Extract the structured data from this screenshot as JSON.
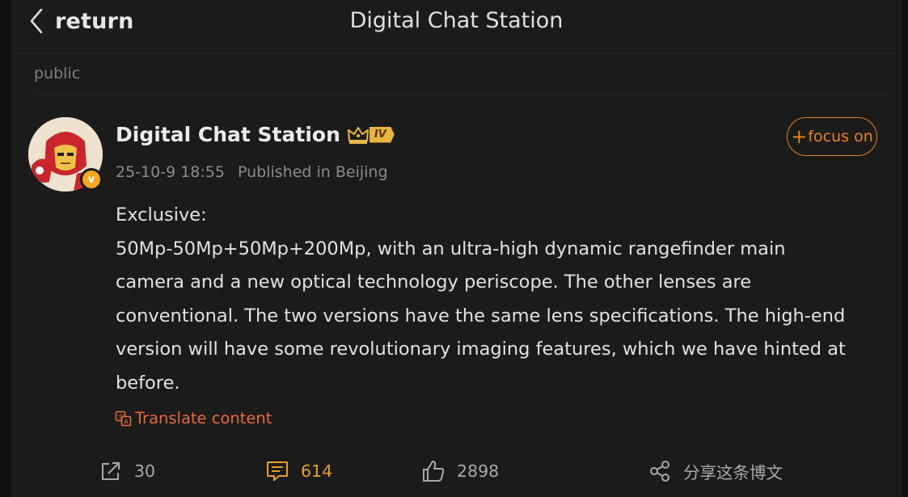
{
  "header": {
    "back_label": "return",
    "title": "Digital Chat Station"
  },
  "visibility": "public",
  "post": {
    "author": "Digital Chat Station",
    "level_badge": "IV",
    "verified_badge": "v",
    "date": "25-10-9 18:55",
    "location": "Published in Beijing",
    "follow_label": "focus on",
    "follow_prefix": "+",
    "content_lines": [
      "Exclusive:",
      "50Mp-50Mp+50Mp+200Mp, with an ultra-high dynamic rangefinder main",
      "camera and a new optical technology periscope. The other lenses are",
      "conventional. The two versions have the same lens specifications. The high-end",
      "version will have some revolutionary imaging features, which we have hinted at",
      "before."
    ],
    "translate_label": "Translate content"
  },
  "actions": {
    "repost_count": "30",
    "comment_count": "614",
    "like_count": "2898",
    "share_label": "分享这条博文"
  },
  "colors": {
    "accent_orange": "#e8821f",
    "comment_gold": "#e7a02a",
    "translate_red": "#e36b3e",
    "background": "#1b1b1b"
  },
  "icons": {
    "back": "chevron-left-icon",
    "crown": "crown-icon",
    "translate": "translate-icon",
    "repost": "repost-icon",
    "comment": "comment-icon",
    "like": "thumbs-up-icon",
    "share": "share-icon"
  }
}
